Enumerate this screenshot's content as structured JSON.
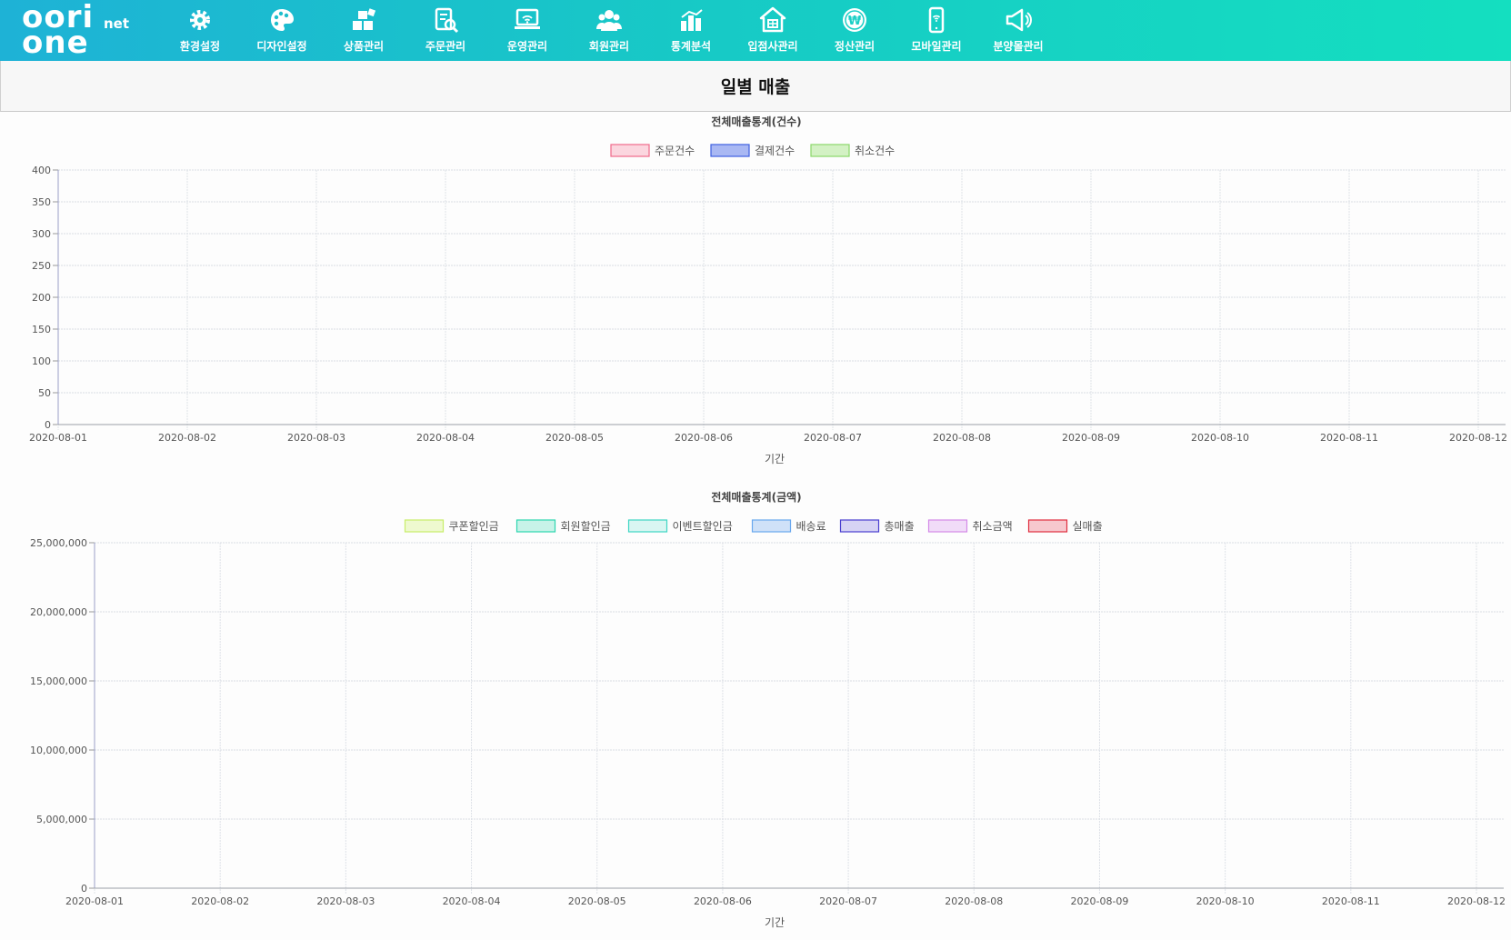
{
  "brand": {
    "logo_line1": "oori",
    "logo_line2": "one",
    "logo_suffix": "net"
  },
  "nav": [
    {
      "label": "환경설정",
      "icon": "gear-icon"
    },
    {
      "label": "디자인설정",
      "icon": "palette-icon"
    },
    {
      "label": "상품관리",
      "icon": "boxes-icon"
    },
    {
      "label": "주문관리",
      "icon": "order-search-icon"
    },
    {
      "label": "운영관리",
      "icon": "laptop-wifi-icon"
    },
    {
      "label": "회원관리",
      "icon": "members-icon"
    },
    {
      "label": "통계분석",
      "icon": "bar-chart-icon"
    },
    {
      "label": "입점사관리",
      "icon": "store-icon"
    },
    {
      "label": "정산관리",
      "icon": "won-coin-icon"
    },
    {
      "label": "모바일관리",
      "icon": "mobile-icon"
    },
    {
      "label": "분양몰관리",
      "icon": "megaphone-icon"
    }
  ],
  "page_title": "일별 매출",
  "chart_data": [
    {
      "type": "line",
      "title": "전체매출통계(건수)",
      "xlabel": "기간",
      "ylabel": "",
      "ylim": [
        0,
        400
      ],
      "yticks": [
        "0",
        "50",
        "100",
        "150",
        "200",
        "250",
        "300",
        "350",
        "400"
      ],
      "x": [
        "2020-08-01",
        "2020-08-02",
        "2020-08-03",
        "2020-08-04",
        "2020-08-05",
        "2020-08-06",
        "2020-08-07",
        "2020-08-08",
        "2020-08-09",
        "2020-08-10",
        "2020-08-11",
        "2020-08-12"
      ],
      "grid": true,
      "legend_position": "top",
      "series": [
        {
          "name": "주문건수",
          "color": "#f06a8a",
          "fill": "#fbd6df",
          "values": []
        },
        {
          "name": "결제건수",
          "color": "#3d5fe0",
          "fill": "#a9b8f3",
          "values": []
        },
        {
          "name": "취소건수",
          "color": "#8bd86a",
          "fill": "#d3f1c4",
          "values": []
        }
      ]
    },
    {
      "type": "line",
      "title": "전체매출통계(금액)",
      "xlabel": "기간",
      "ylabel": "",
      "ylim": [
        0,
        25000000
      ],
      "yticks": [
        "0",
        "5,000,000",
        "10,000,000",
        "15,000,000",
        "20,000,000",
        "25,000,000"
      ],
      "x": [
        "2020-08-01",
        "2020-08-02",
        "2020-08-03",
        "2020-08-04",
        "2020-08-05",
        "2020-08-06",
        "2020-08-07",
        "2020-08-08",
        "2020-08-09",
        "2020-08-10",
        "2020-08-11",
        "2020-08-12"
      ],
      "grid": true,
      "legend_position": "top",
      "series": [
        {
          "name": "쿠폰할인금",
          "color": "#c8ee6a",
          "fill": "#eef9cf",
          "values": []
        },
        {
          "name": "회원할인금",
          "color": "#2ed6b0",
          "fill": "#c7f3e8",
          "values": []
        },
        {
          "name": "이벤트할인금",
          "color": "#3fd6c4",
          "fill": "#d9f6f2",
          "values": []
        },
        {
          "name": "배송료",
          "color": "#6aa8ee",
          "fill": "#cfe1f8",
          "values": []
        },
        {
          "name": "총매출",
          "color": "#4a3fd0",
          "fill": "#d6d3f4",
          "values": []
        },
        {
          "name": "취소금액",
          "color": "#d48ae8",
          "fill": "#f1dcf8",
          "values": []
        },
        {
          "name": "실매출",
          "color": "#e03040",
          "fill": "#f7c8ce",
          "values": []
        }
      ]
    }
  ]
}
